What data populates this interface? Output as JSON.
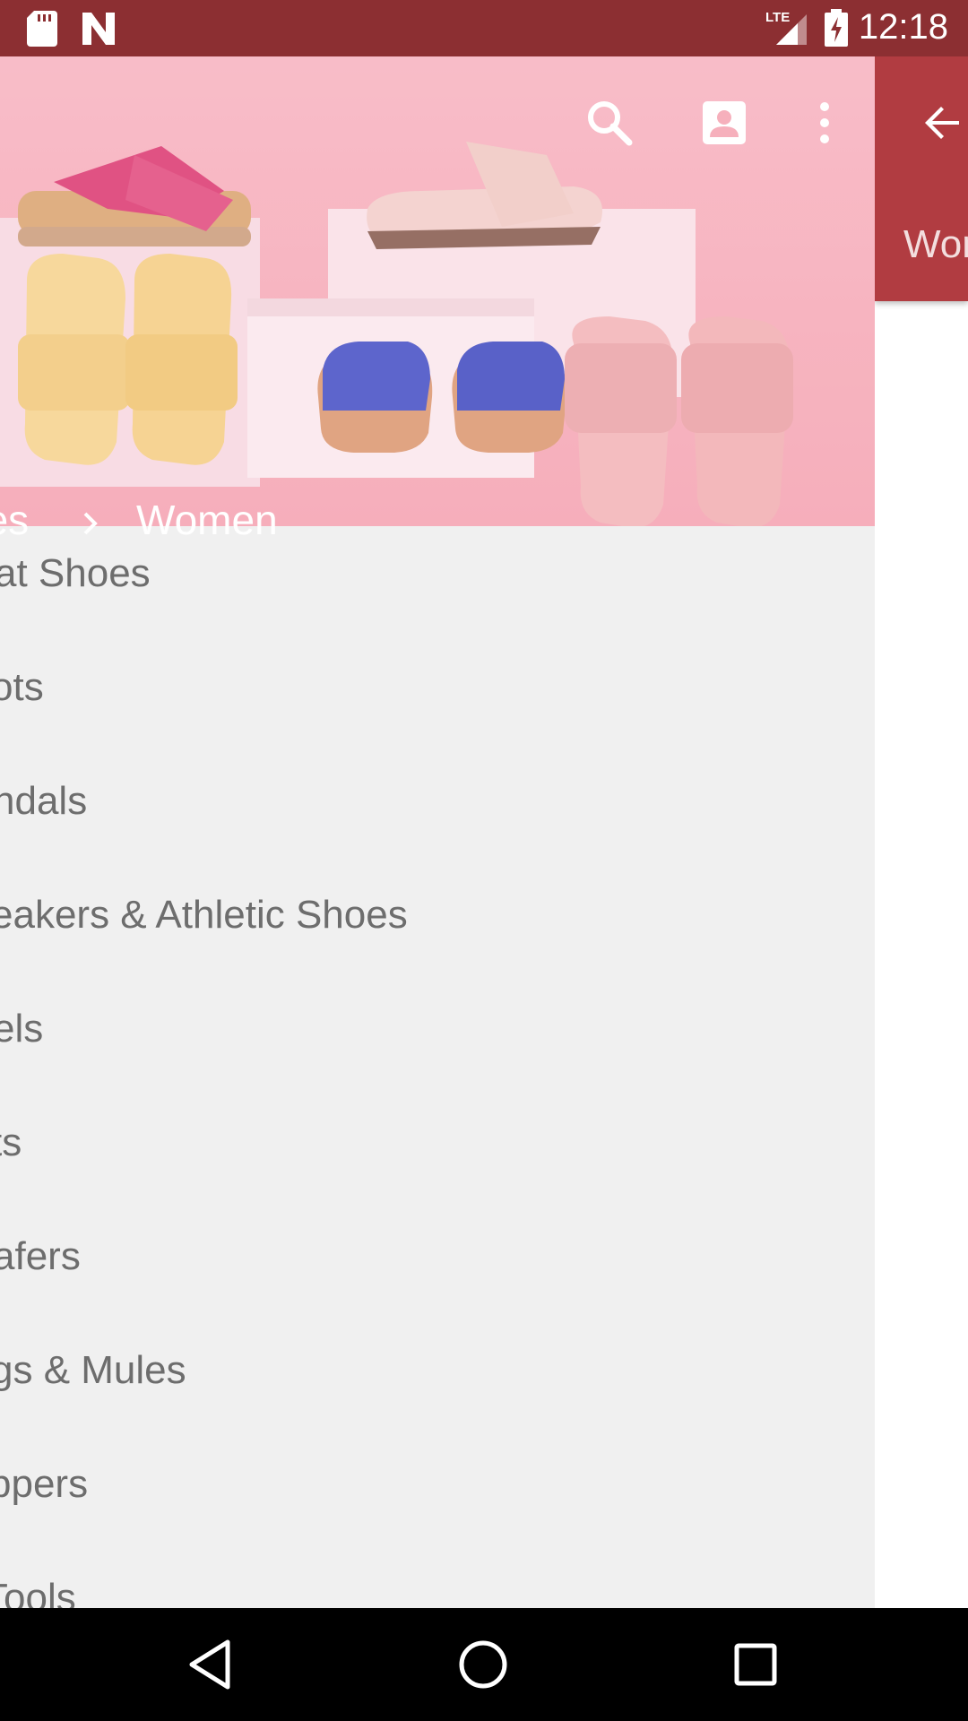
{
  "status_bar": {
    "time": "12:18",
    "network": "LTE",
    "left_icons": [
      "sd-card-icon",
      "n-notification-icon"
    ],
    "right_icons": [
      "lte-signal-icon",
      "battery-charging-icon"
    ]
  },
  "toolbar": {
    "icons": [
      "search-icon",
      "account-icon",
      "more-vert-icon"
    ]
  },
  "breadcrumb": {
    "previous": "oes",
    "current": "Women"
  },
  "categories": [
    "at Shoes",
    "ots",
    "ndals",
    "eakers & Athletic Shoes",
    "els",
    "ts",
    "afers",
    "gs & Mules",
    "ppers",
    "Tools"
  ],
  "right_page": {
    "tab_label": "Wor",
    "back_icon": "arrow-back-icon"
  },
  "nav_bar": {
    "icons": [
      "back-triangle-icon",
      "home-circle-icon",
      "recents-square-icon"
    ]
  },
  "colors": {
    "status_bar": "#8c2f32",
    "toolbar_red": "#b13c41",
    "list_background": "#f0f0f0",
    "list_text": "#6d6d6d"
  }
}
